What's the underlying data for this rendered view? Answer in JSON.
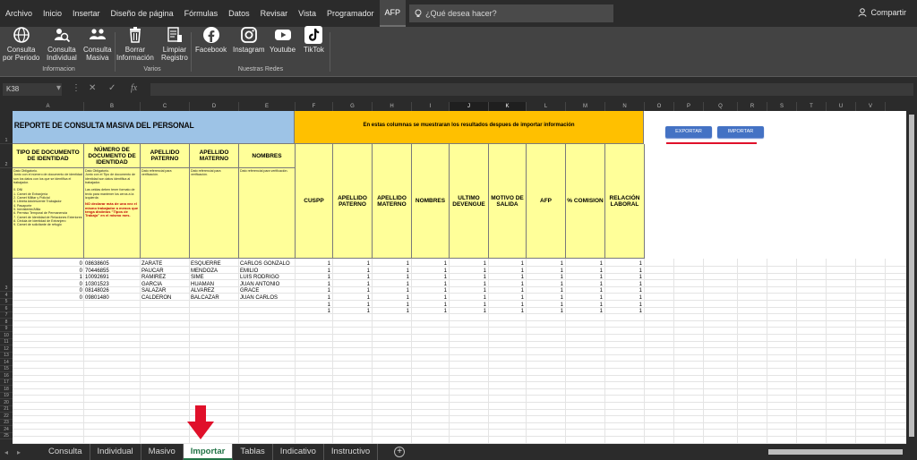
{
  "menu": [
    "Archivo",
    "Inicio",
    "Insertar",
    "Diseño de página",
    "Fórmulas",
    "Datos",
    "Revisar",
    "Vista",
    "Programador",
    "AFP"
  ],
  "search_placeholder": "¿Qué desea hacer?",
  "share_label": "Compartir",
  "ribbon": {
    "buttons": [
      {
        "l1": "Consulta",
        "l2": "por Periodo",
        "icon": "globe-icon"
      },
      {
        "l1": "Consulta",
        "l2": "Individual",
        "icon": "person-search-icon"
      },
      {
        "l1": "Consulta",
        "l2": "Masiva",
        "icon": "group-icon"
      },
      {
        "l1": "Borrar",
        "l2": "Información",
        "icon": "trash-icon"
      },
      {
        "l1": "Limpiar",
        "l2": "Registro",
        "icon": "document-icon"
      },
      {
        "l1": "Facebook",
        "l2": "",
        "icon": "facebook-icon"
      },
      {
        "l1": "Instagram",
        "l2": "",
        "icon": "instagram-icon"
      },
      {
        "l1": "Youtube",
        "l2": "",
        "icon": "youtube-icon"
      },
      {
        "l1": "TikTok",
        "l2": "",
        "icon": "tiktok-icon"
      }
    ],
    "groups": [
      "Informacion",
      "Varios",
      "Nuestras Redes"
    ]
  },
  "name_box": "K38",
  "columns": [
    "A",
    "B",
    "C",
    "D",
    "E",
    "F",
    "G",
    "H",
    "I",
    "J",
    "K",
    "L",
    "M",
    "N",
    "O",
    "P",
    "Q",
    "R",
    "S",
    "T",
    "U",
    "V"
  ],
  "selected_columns": [
    "J",
    "K"
  ],
  "rows": [
    "1",
    "2",
    "3",
    "4",
    "5",
    "6",
    "7",
    "8",
    "9",
    "10",
    "11",
    "12",
    "13",
    "14",
    "15",
    "16",
    "17",
    "18",
    "19",
    "20",
    "21",
    "22",
    "23",
    "24",
    "25",
    "26",
    "27",
    "28",
    "29",
    "30",
    "31",
    "32",
    "33",
    "34",
    "35",
    "36",
    "37",
    "38",
    "39",
    "40",
    "41",
    "42",
    "43",
    "44",
    "45",
    "46",
    "47",
    "48",
    "49",
    "50",
    "51",
    "52",
    "53"
  ],
  "sheet": {
    "title": "REPORTE DE CONSULTA MASIVA DEL PERSONAL",
    "banner": "En estas columnas se muestraran los resultados despues de importar información",
    "export_label": "EXPORTAR",
    "import_label": "IMPORTAR",
    "input_headers": [
      "TIPO DE DOCUMENTO DE IDENTIDAD",
      "NÚMERO DE DOCUMENTO DE IDENTIDAD",
      "APELLIDO PATERNO",
      "APELLIDO MATERNO",
      "NOMBRES"
    ],
    "result_headers": [
      "CUSPP",
      "APELLIDO PATERNO",
      "APELLIDO MATERNO",
      "NOMBRES",
      "ULTIMO DEVENGUE",
      "MOTIVO DE SALIDA",
      "AFP",
      "% COMISION",
      "RELACIÓN LABORAL"
    ],
    "desc_a": "Dato Obligatorio.\nJunto con el número de documento de identidad son los datos con los que se identifica el trabajador.\n\n0. DNI\n1. Carnet de Extranjería\n2. Carnet Militar y Policial\n3. Libreta Adolescente Trabajador\n4. Pasaporte\n5. Inexistente/Afilia\n6. Permiso Temporal de Permanencia\n7. Carnet de Identidad de Relaciones Exteriores\n8. Cédula de Identidad de Extranjero\n9. Carnet de solicitante de refugio",
    "desc_b": "Dato Obligatorio.\nJunto con el Tipo de documento de identidad son datos identifica al trabajador.\n\nLas celdas deben tener formato de texto para mantener los ceros a la izquierda",
    "desc_b_red": "NO declarar más de una vez el mismo trabajador a menos que tenga distintos \"Tipos de Trabajo\" en el mismo mes.",
    "desc_ref": "Dato referencial para verificación.",
    "data_rows": [
      {
        "a": "0",
        "b": "08638605",
        "c": "ZARATE",
        "d": "ESQUERRE",
        "e": "CARLOS GONZALO",
        "vals": [
          "1",
          "1",
          "1",
          "1",
          "1",
          "1",
          "1",
          "1",
          "1"
        ]
      },
      {
        "a": "0",
        "b": "70446855",
        "c": "PAUCAR",
        "d": "MENDOZA",
        "e": "EMILIO",
        "vals": [
          "1",
          "1",
          "1",
          "1",
          "1",
          "1",
          "1",
          "1",
          "1"
        ]
      },
      {
        "a": "1",
        "b": "10092691",
        "c": "RAMIREZ",
        "d": "SIME",
        "e": "LUIS RODRIGO",
        "vals": [
          "1",
          "1",
          "1",
          "1",
          "1",
          "1",
          "1",
          "1",
          "1"
        ]
      },
      {
        "a": "0",
        "b": "10301523",
        "c": "GARCIA",
        "d": "HUAMAN",
        "e": "JUAN ANTONIO",
        "vals": [
          "1",
          "1",
          "1",
          "1",
          "1",
          "1",
          "1",
          "1",
          "1"
        ]
      },
      {
        "a": "0",
        "b": "08148026",
        "c": "SALAZAR",
        "d": "ALVAREZ",
        "e": "GRACE",
        "vals": [
          "1",
          "1",
          "1",
          "1",
          "1",
          "1",
          "1",
          "1",
          "1"
        ]
      },
      {
        "a": "0",
        "b": "09801480",
        "c": "CALDERON",
        "d": "BALCAZAR",
        "e": "JUAN CARLOS",
        "vals": [
          "1",
          "1",
          "1",
          "1",
          "1",
          "1",
          "1",
          "1",
          "1"
        ]
      },
      {
        "a": "",
        "b": "",
        "c": "",
        "d": "",
        "e": "",
        "vals": [
          "1",
          "1",
          "1",
          "1",
          "1",
          "1",
          "1",
          "1",
          "1"
        ]
      },
      {
        "a": "",
        "b": "",
        "c": "",
        "d": "",
        "e": "",
        "vals": [
          "1",
          "1",
          "1",
          "1",
          "1",
          "1",
          "1",
          "1",
          "1"
        ]
      }
    ]
  },
  "tabs": [
    "Consulta",
    "Individual",
    "Masivo",
    "Importar",
    "Tablas",
    "Indicativo",
    "Instructivo"
  ],
  "active_tab": "Importar",
  "colors": {
    "accent": "#217346",
    "button": "#4472c4",
    "arrow": "#e0102a",
    "yellow": "#ffff99",
    "blue": "#9dc3e6",
    "orange": "#ffc000"
  }
}
